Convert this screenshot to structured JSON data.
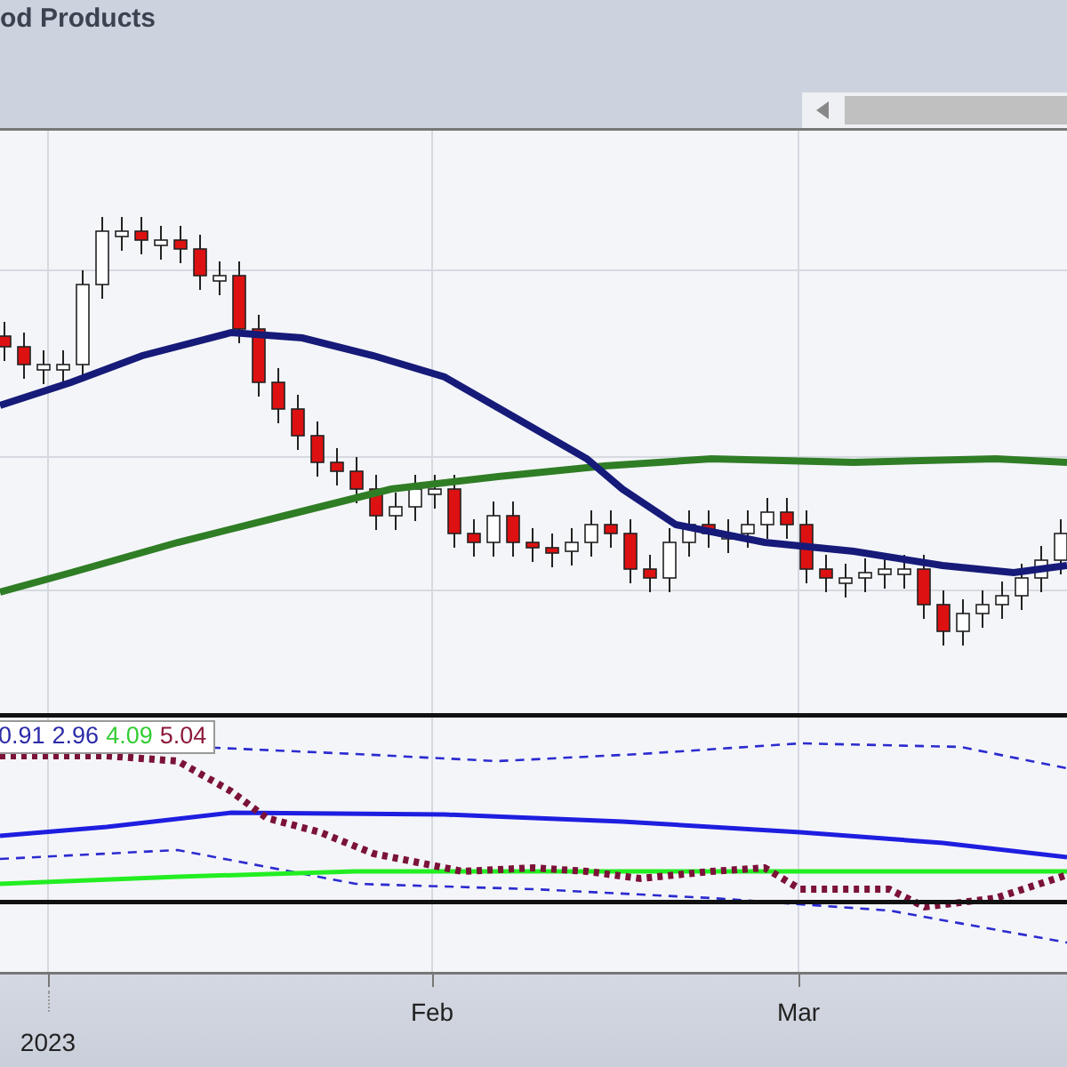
{
  "title": "od Products",
  "indicator_values": [
    {
      "text": "0.91",
      "color": "#2b2ba8"
    },
    {
      "text": "2.96",
      "color": "#2b2ba8"
    },
    {
      "text": "4.09",
      "color": "#33cc33"
    },
    {
      "text": "5.04",
      "color": "#8b1a3a"
    }
  ],
  "x_axis": {
    "labels": [
      {
        "text": "2023",
        "kind": "year"
      },
      {
        "text": "Feb",
        "kind": "month"
      },
      {
        "text": "Mar",
        "kind": "month"
      }
    ]
  }
}
